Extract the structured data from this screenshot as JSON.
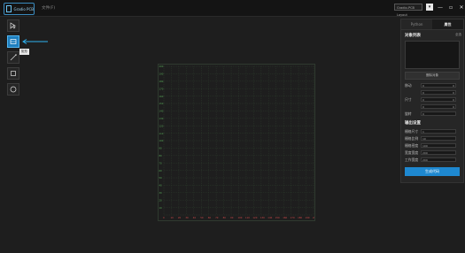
{
  "titlebar": {
    "app_name": "Gradio PCB",
    "menu_item": "文件(F)",
    "dropdown_value": "Gradio-PCB Layout",
    "dropdown_arrow": "▾",
    "minimize": "—",
    "maximize": "▫",
    "close": "✕"
  },
  "toolbar": {
    "tools": [
      "select-icon",
      "rectangle-select-icon",
      "line-icon",
      "square-icon",
      "circle-icon"
    ],
    "tooltip": "矩形"
  },
  "canvas": {
    "y_labels": [
      "200",
      "190",
      "180",
      "170",
      "160",
      "150",
      "140",
      "130",
      "120",
      "110",
      "100",
      "90",
      "80",
      "70",
      "60",
      "50",
      "40",
      "30",
      "20",
      "10"
    ],
    "x_labels": [
      "0",
      "10",
      "20",
      "30",
      "40",
      "50",
      "60",
      "70",
      "80",
      "90",
      "100",
      "110",
      "120",
      "130",
      "140",
      "150",
      "160",
      "170",
      "180",
      "190",
      "200"
    ]
  },
  "panel": {
    "tabs": [
      "Python",
      "属性"
    ],
    "active_tab": 1,
    "object_list_title": "对象列表",
    "object_list_option": "全选",
    "delete_button": "删除对象",
    "props": [
      {
        "label": "移动",
        "v1": "0",
        "v2": "0"
      },
      {
        "label": "",
        "v1": "0",
        "v2": "0"
      },
      {
        "label": "尺寸",
        "v1": "0",
        "v2": "0"
      },
      {
        "label": "",
        "v1": "0",
        "v2": "0"
      },
      {
        "label": "旋转",
        "v1": "0",
        "v2": ""
      }
    ],
    "output_title": "输出设置",
    "output_props": [
      {
        "label": "栅格尺寸",
        "value": "1"
      },
      {
        "label": "栅格比例",
        "value": "10"
      },
      {
        "label": "栅格密度",
        "value": "100"
      },
      {
        "label": "宽度宽度",
        "value": "200"
      },
      {
        "label": "工作宽度",
        "value": "200"
      }
    ],
    "generate_button": "生成代码"
  }
}
